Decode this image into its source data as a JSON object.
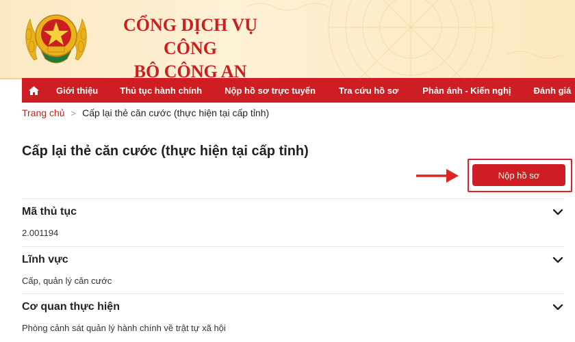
{
  "header": {
    "title_line1": "CỔNG DỊCH VỤ CÔNG",
    "title_line2": "BỘ CÔNG AN",
    "brand_color": "#cf1e23",
    "background_color": "#fdf1d6"
  },
  "nav": {
    "home_icon": "home-icon",
    "items": [
      {
        "label": "Giới thiệu"
      },
      {
        "label": "Thủ tục hành chính"
      },
      {
        "label": "Nộp hồ sơ trực tuyến"
      },
      {
        "label": "Tra cứu hồ sơ"
      },
      {
        "label": "Phản ánh - Kiến nghị"
      },
      {
        "label": "Đánh giá"
      }
    ]
  },
  "breadcrumb": {
    "home": "Trang chủ",
    "separator": ">",
    "current": "Cấp lại thẻ căn cước (thực hiện tại cấp tỉnh)"
  },
  "page": {
    "title": "Cấp lại thẻ căn cước (thực hiện tại cấp tỉnh)",
    "submit_label": "Nộp hồ sơ"
  },
  "sections": [
    {
      "title": "Mã thủ tục",
      "value": "2.001194",
      "icon": "chevron-down-icon"
    },
    {
      "title": "Lĩnh vực",
      "value": "Cấp, quản lý căn cước",
      "icon": "chevron-down-icon"
    },
    {
      "title": "Cơ quan thực hiện",
      "value": "Phòng cảnh sát quản lý hành chính về trật tự xã hội",
      "icon": "chevron-down-icon"
    }
  ]
}
